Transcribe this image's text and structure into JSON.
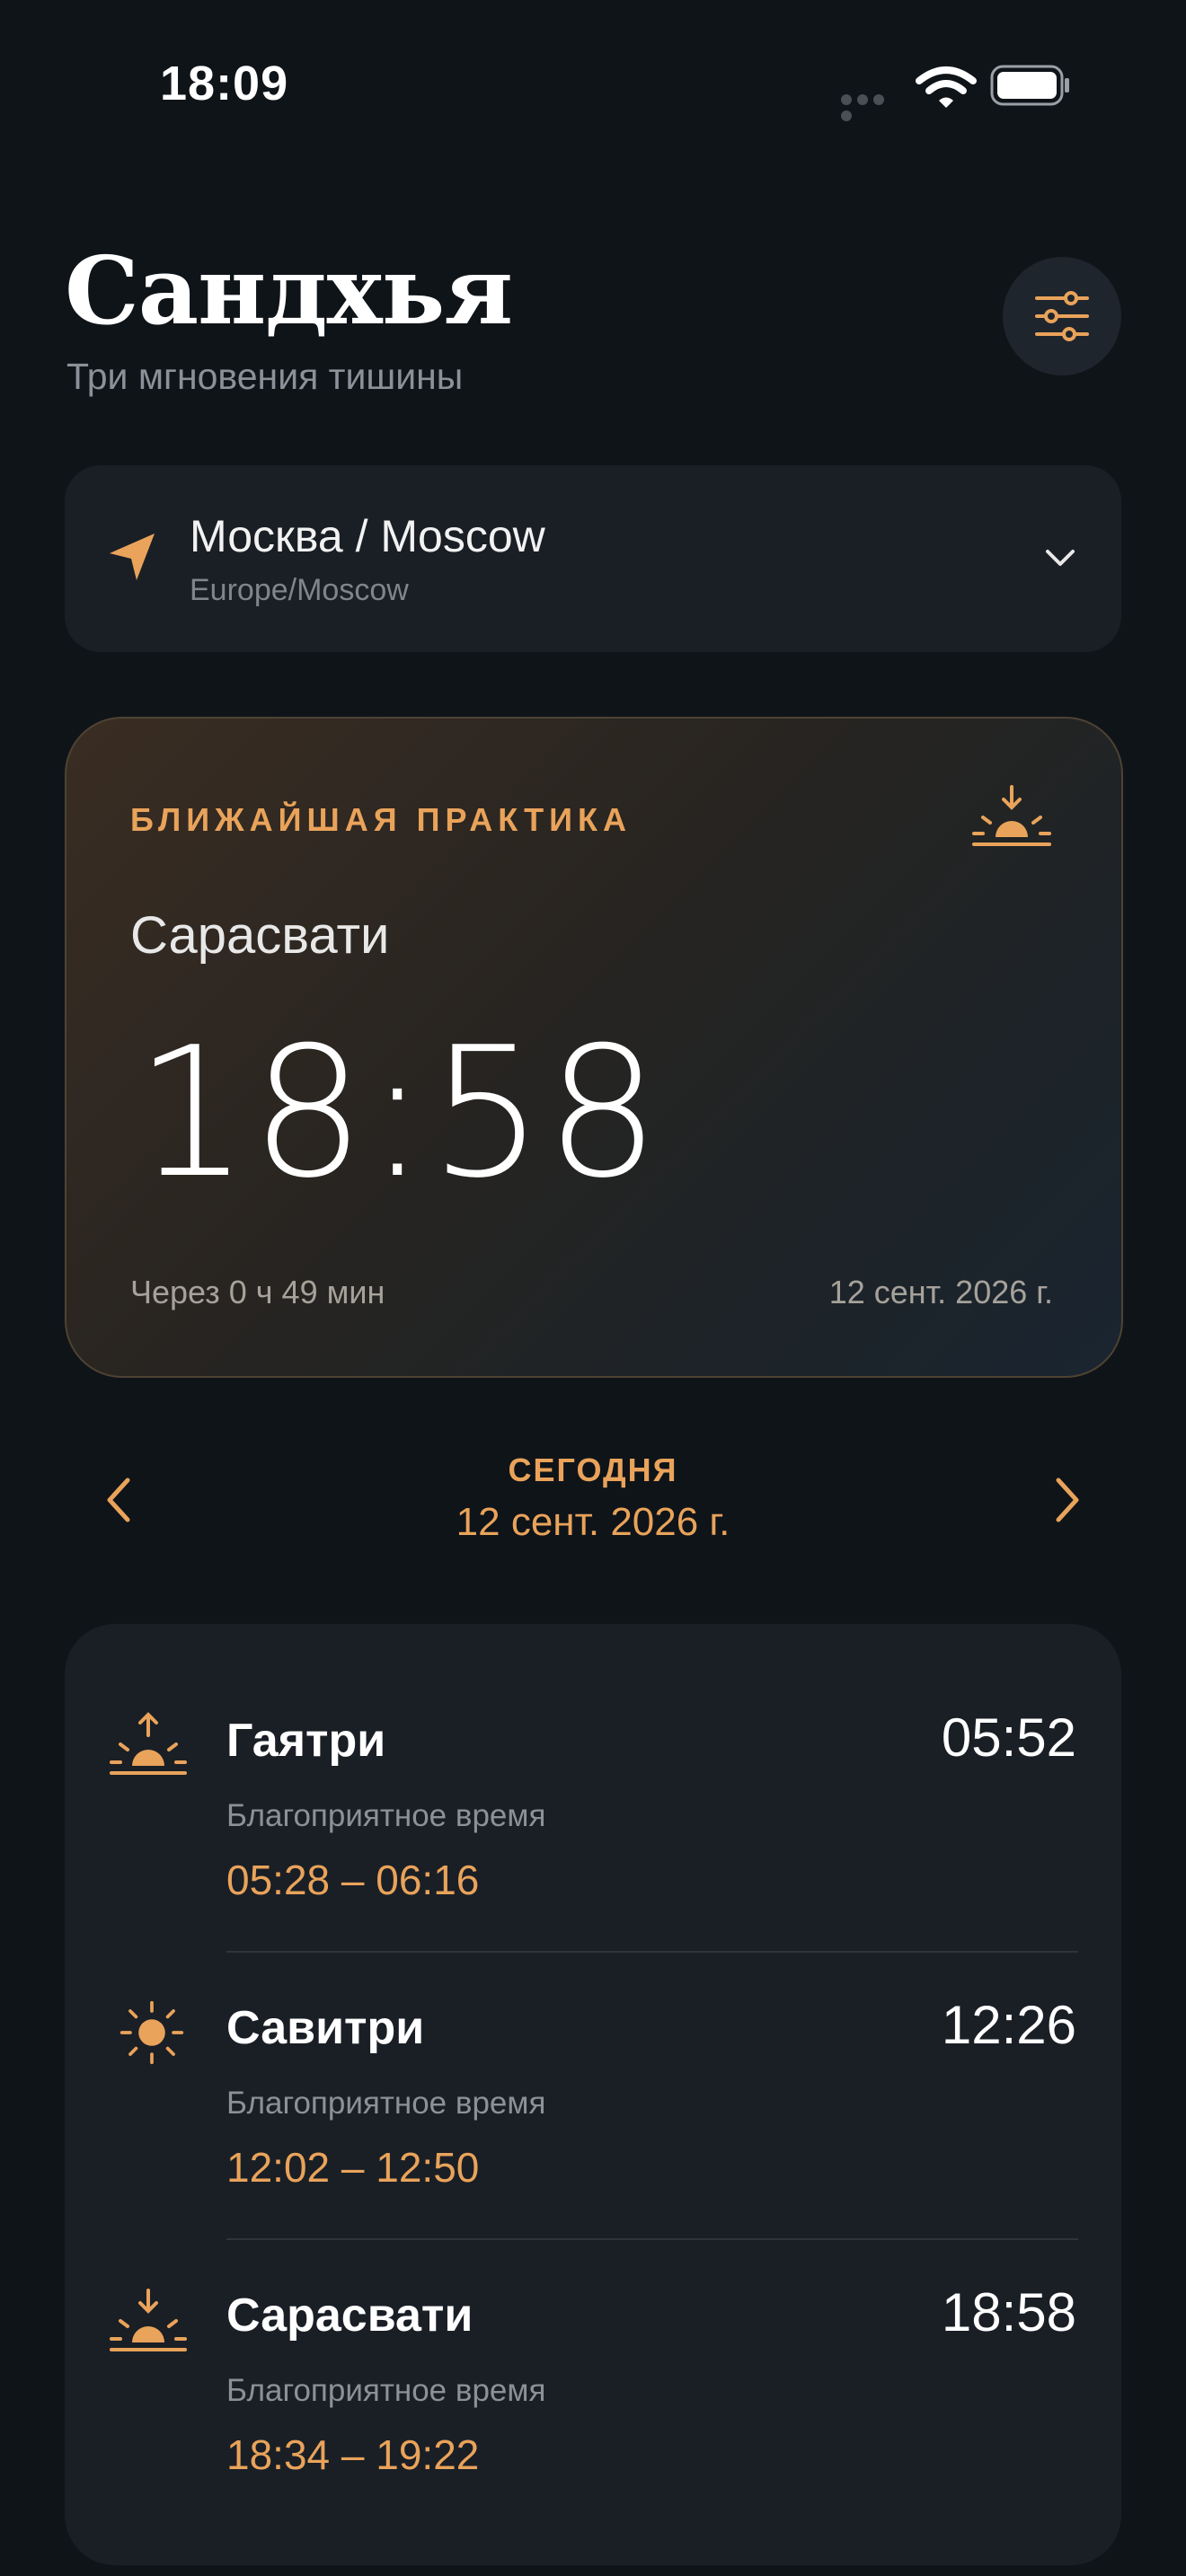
{
  "status_bar": {
    "time": "18:09"
  },
  "header": {
    "title": "Сандхья",
    "subtitle": "Три мгновения тишины",
    "settings_icon": "sliders-icon"
  },
  "location": {
    "name": "Москва / Moscow",
    "timezone": "Europe/Moscow",
    "icon": "location-arrow-icon"
  },
  "next_practice": {
    "label": "БЛИЖАЙШАЯ ПРАКТИКА",
    "name": "Сарасвати",
    "time": "18:58",
    "remaining": "Через 0 ч 49 мин",
    "date": "12 сент. 2026 г.",
    "icon": "sunset-icon"
  },
  "date_nav": {
    "label": "СЕГОДНЯ",
    "date": "12 сент. 2026 г."
  },
  "practices": [
    {
      "name": "Гаятри",
      "time": "05:52",
      "subtitle": "Благоприятное время",
      "window": "05:28 – 06:16",
      "icon": "sunrise-icon"
    },
    {
      "name": "Савитри",
      "time": "12:26",
      "subtitle": "Благоприятное время",
      "window": "12:02 – 12:50",
      "icon": "sun-icon"
    },
    {
      "name": "Сарасвати",
      "time": "18:58",
      "subtitle": "Благоприятное время",
      "window": "18:34 – 19:22",
      "icon": "sunset-icon"
    }
  ],
  "colors": {
    "accent": "#e9a35a",
    "background": "#0f1419",
    "card": "#1a1f26"
  }
}
